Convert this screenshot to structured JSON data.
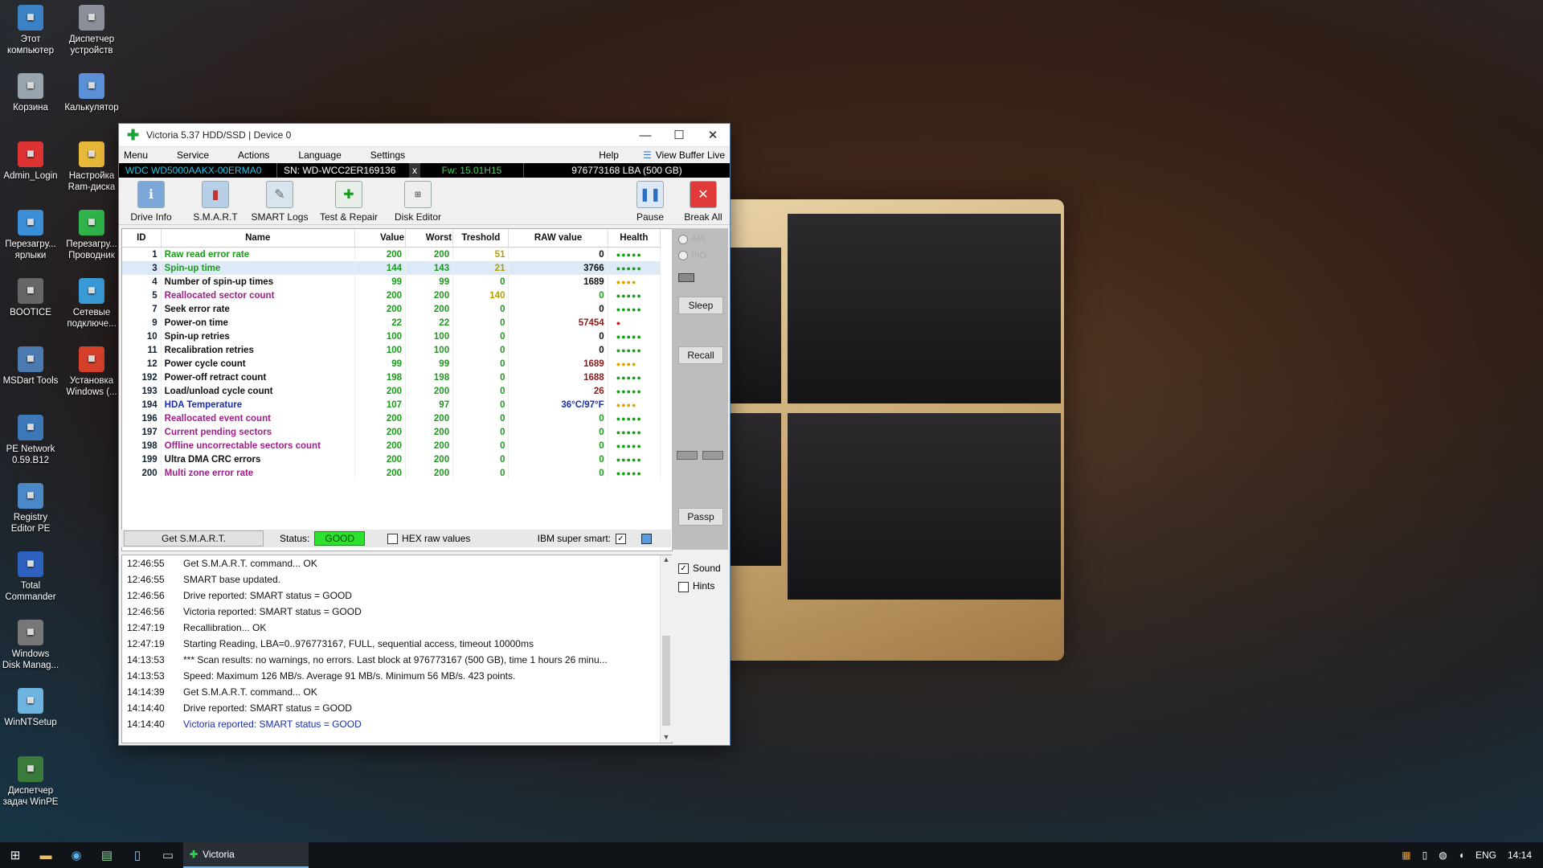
{
  "desktop_icons": [
    {
      "label": "Этот\nкомпьютер",
      "icon": "computer-icon",
      "color": "#3b82c4"
    },
    {
      "label": "Диспетчер\nустройств",
      "icon": "device-manager-icon",
      "color": "#8a8f99"
    },
    {
      "label": "Корзина",
      "icon": "recycle-bin-icon",
      "color": "#9aa4ad"
    },
    {
      "label": "Калькулятор",
      "icon": "calculator-icon",
      "color": "#5b8fd6"
    },
    {
      "label": "Admin_Login",
      "icon": "admin-icon",
      "color": "#d33"
    },
    {
      "label": "Настройка\nRam-диска",
      "icon": "ramdisk-icon",
      "color": "#e8b83a"
    },
    {
      "label": "Перезагру...\nярлыки",
      "icon": "reload-shortcuts-icon",
      "color": "#3a8fd6"
    },
    {
      "label": "Перезагру...\nПроводник",
      "icon": "reload-explorer-icon",
      "color": "#2fb34a"
    },
    {
      "label": "BOOTICE",
      "icon": "bootice-icon",
      "color": "#666"
    },
    {
      "label": "Сетевые\nподключе...",
      "icon": "network-icon",
      "color": "#3a9ad6"
    },
    {
      "label": "MSDart Tools",
      "icon": "msdart-icon",
      "color": "#4a7ab0"
    },
    {
      "label": "Установка\nWindows (...",
      "icon": "windows-setup-icon",
      "color": "#d5402b"
    },
    {
      "label": "PE Network\n0.59.B12",
      "icon": "pe-network-icon",
      "color": "#3c78b8"
    },
    {
      "label": "Registry\nEditor PE",
      "icon": "registry-icon",
      "color": "#4a88c8"
    },
    {
      "label": "Total\nCommander",
      "icon": "total-commander-icon",
      "color": "#2e62c0"
    },
    {
      "label": "Windows\nDisk Manag...",
      "icon": "disk-manager-icon",
      "color": "#777"
    },
    {
      "label": "WinNTSetup",
      "icon": "winntsetup-icon",
      "color": "#6fb4e0"
    },
    {
      "label": "Диспетчер\nзадач WinPE",
      "icon": "task-manager-icon",
      "color": "#3a7a3a"
    }
  ],
  "window": {
    "title": "Victoria 5.37 HDD/SSD | Device 0",
    "menu": [
      "Menu",
      "Service",
      "Actions",
      "Language",
      "Settings"
    ],
    "help": "Help",
    "view_buffer": "View Buffer Live",
    "model": "WDC WD5000AAKX-00ERMA0",
    "serial": "SN: WD-WCC2ER169136",
    "x": "x",
    "firmware": "Fw: 15.01H15",
    "capacity": "976773168 LBA (500 GB)",
    "tools": [
      {
        "label": "Drive Info",
        "icon": "drive-info-icon",
        "glyph": "ℹ"
      },
      {
        "label": "S.M.A.R.T",
        "icon": "smart-icon",
        "glyph": "▮"
      },
      {
        "label": "SMART Logs",
        "icon": "smart-logs-icon",
        "glyph": "✎"
      },
      {
        "label": "Test & Repair",
        "icon": "test-repair-icon",
        "glyph": "✚"
      },
      {
        "label": "Disk Editor",
        "icon": "disk-editor-icon",
        "glyph": "⊞"
      }
    ],
    "pause": "Pause",
    "break_all": "Break All"
  },
  "smart_table": {
    "headers": [
      "ID",
      "Name",
      "Value",
      "Worst",
      "Treshold",
      "RAW value",
      "Health"
    ],
    "rows": [
      {
        "id": "1",
        "name": "Raw read error rate",
        "value": "200",
        "worst": "200",
        "thr": "51",
        "raw": "0",
        "health": "●●●●●",
        "name_color": "#1c9a1c",
        "health_color": "#1c9a1c",
        "thr_color": "#b0a000",
        "raw_color": "#111"
      },
      {
        "id": "3",
        "name": "Spin-up time",
        "value": "144",
        "worst": "143",
        "thr": "21",
        "raw": "3766",
        "health": "●●●●●",
        "name_color": "#1c9a1c",
        "health_color": "#1c9a1c",
        "thr_color": "#b0a000",
        "raw_color": "#111"
      },
      {
        "id": "4",
        "name": "Number of spin-up times",
        "value": "99",
        "worst": "99",
        "thr": "0",
        "raw": "1689",
        "health": "●●●●",
        "name_color": "#111",
        "health_color": "#e0a000",
        "thr_color": "#1c9a1c",
        "raw_color": "#111"
      },
      {
        "id": "5",
        "name": "Reallocated sector count",
        "value": "200",
        "worst": "200",
        "thr": "140",
        "raw": "0",
        "health": "●●●●●",
        "name_color": "#a0208a",
        "health_color": "#1c9a1c",
        "thr_color": "#b0a000",
        "raw_color": "#1c9a1c"
      },
      {
        "id": "7",
        "name": "Seek error rate",
        "value": "200",
        "worst": "200",
        "thr": "0",
        "raw": "0",
        "health": "●●●●●",
        "name_color": "#111",
        "health_color": "#1c9a1c",
        "thr_color": "#1c9a1c",
        "raw_color": "#111"
      },
      {
        "id": "9",
        "name": "Power-on time",
        "value": "22",
        "worst": "22",
        "thr": "0",
        "raw": "57454",
        "health": "●",
        "name_color": "#111",
        "health_color": "#d01010",
        "thr_color": "#1c9a1c",
        "raw_color": "#8b1a1a"
      },
      {
        "id": "10",
        "name": "Spin-up retries",
        "value": "100",
        "worst": "100",
        "thr": "0",
        "raw": "0",
        "health": "●●●●●",
        "name_color": "#111",
        "health_color": "#1c9a1c",
        "thr_color": "#1c9a1c",
        "raw_color": "#111"
      },
      {
        "id": "11",
        "name": "Recalibration retries",
        "value": "100",
        "worst": "100",
        "thr": "0",
        "raw": "0",
        "health": "●●●●●",
        "name_color": "#111",
        "health_color": "#1c9a1c",
        "thr_color": "#1c9a1c",
        "raw_color": "#111"
      },
      {
        "id": "12",
        "name": "Power cycle count",
        "value": "99",
        "worst": "99",
        "thr": "0",
        "raw": "1689",
        "health": "●●●●",
        "name_color": "#111",
        "health_color": "#e0a000",
        "thr_color": "#1c9a1c",
        "raw_color": "#8b1a1a"
      },
      {
        "id": "192",
        "name": "Power-off retract count",
        "value": "198",
        "worst": "198",
        "thr": "0",
        "raw": "1688",
        "health": "●●●●●",
        "name_color": "#111",
        "health_color": "#1c9a1c",
        "thr_color": "#1c9a1c",
        "raw_color": "#8b1a1a"
      },
      {
        "id": "193",
        "name": "Load/unload cycle count",
        "value": "200",
        "worst": "200",
        "thr": "0",
        "raw": "26",
        "health": "●●●●●",
        "name_color": "#111",
        "health_color": "#1c9a1c",
        "thr_color": "#1c9a1c",
        "raw_color": "#8b1a1a"
      },
      {
        "id": "194",
        "name": "HDA Temperature",
        "value": "107",
        "worst": "97",
        "thr": "0",
        "raw": "36°C/97°F",
        "health": "●●●●",
        "name_color": "#1a2fb0",
        "health_color": "#e0a000",
        "thr_color": "#1c9a1c",
        "raw_color": "#1a2fb0"
      },
      {
        "id": "196",
        "name": "Reallocated event count",
        "value": "200",
        "worst": "200",
        "thr": "0",
        "raw": "0",
        "health": "●●●●●",
        "name_color": "#a0208a",
        "health_color": "#1c9a1c",
        "thr_color": "#1c9a1c",
        "raw_color": "#1c9a1c"
      },
      {
        "id": "197",
        "name": "Current pending sectors",
        "value": "200",
        "worst": "200",
        "thr": "0",
        "raw": "0",
        "health": "●●●●●",
        "name_color": "#a0208a",
        "health_color": "#1c9a1c",
        "thr_color": "#1c9a1c",
        "raw_color": "#1c9a1c"
      },
      {
        "id": "198",
        "name": "Offline uncorrectable sectors count",
        "value": "200",
        "worst": "200",
        "thr": "0",
        "raw": "0",
        "health": "●●●●●",
        "name_color": "#a0208a",
        "health_color": "#1c9a1c",
        "thr_color": "#1c9a1c",
        "raw_color": "#1c9a1c"
      },
      {
        "id": "199",
        "name": "Ultra DMA CRC errors",
        "value": "200",
        "worst": "200",
        "thr": "0",
        "raw": "0",
        "health": "●●●●●",
        "name_color": "#111",
        "health_color": "#1c9a1c",
        "thr_color": "#1c9a1c",
        "raw_color": "#1c9a1c"
      },
      {
        "id": "200",
        "name": "Multi zone error rate",
        "value": "200",
        "worst": "200",
        "thr": "0",
        "raw": "0",
        "health": "●●●●●",
        "name_color": "#a0208a",
        "health_color": "#1c9a1c",
        "thr_color": "#1c9a1c",
        "raw_color": "#1c9a1c"
      }
    ],
    "selected_row": 1
  },
  "status_bar": {
    "get_smart": "Get S.M.A.R.T.",
    "status_label": "Status:",
    "status_value": "GOOD",
    "hex_raw": "HEX raw values",
    "ibm_super_smart": "IBM super smart:",
    "ibm_checked": "✓"
  },
  "right_panel": {
    "api": "API",
    "pio": "PIO",
    "sleep": "Sleep",
    "recall": "Recall",
    "passp": "Passp"
  },
  "log": [
    {
      "time": "12:46:55",
      "msg": "Get S.M.A.R.T. command... OK",
      "color": "#111"
    },
    {
      "time": "12:46:55",
      "msg": "SMART base updated.",
      "color": "#111"
    },
    {
      "time": "12:46:56",
      "msg": "Drive reported: SMART status = GOOD",
      "color": "#111"
    },
    {
      "time": "12:46:56",
      "msg": "Victoria reported: SMART status = GOOD",
      "color": "#111"
    },
    {
      "time": "12:47:19",
      "msg": "Recallibration... OK",
      "color": "#111"
    },
    {
      "time": "12:47:19",
      "msg": "Starting Reading, LBA=0..976773167, FULL, sequential access, timeout 10000ms",
      "color": "#111"
    },
    {
      "time": "14:13:53",
      "msg": "*** Scan results: no warnings, no errors. Last block at 976773167 (500 GB), time 1 hours 26 minu...",
      "color": "#111"
    },
    {
      "time": "14:13:53",
      "msg": "Speed: Maximum 126 MB/s. Average 91 MB/s. Minimum 56 MB/s. 423 points.",
      "color": "#111"
    },
    {
      "time": "14:14:39",
      "msg": "Get S.M.A.R.T. command... OK",
      "color": "#111"
    },
    {
      "time": "14:14:40",
      "msg": "Drive reported: SMART status = GOOD",
      "color": "#111"
    },
    {
      "time": "14:14:40",
      "msg": "Victoria reported: SMART status = GOOD",
      "color": "#1a2fb0"
    }
  ],
  "side_checks": {
    "sound": "Sound",
    "sound_checked": "✓",
    "hints": "Hints"
  },
  "taskbar": {
    "app_label": "Victoria",
    "lang": "ENG",
    "clock": "14:14"
  }
}
